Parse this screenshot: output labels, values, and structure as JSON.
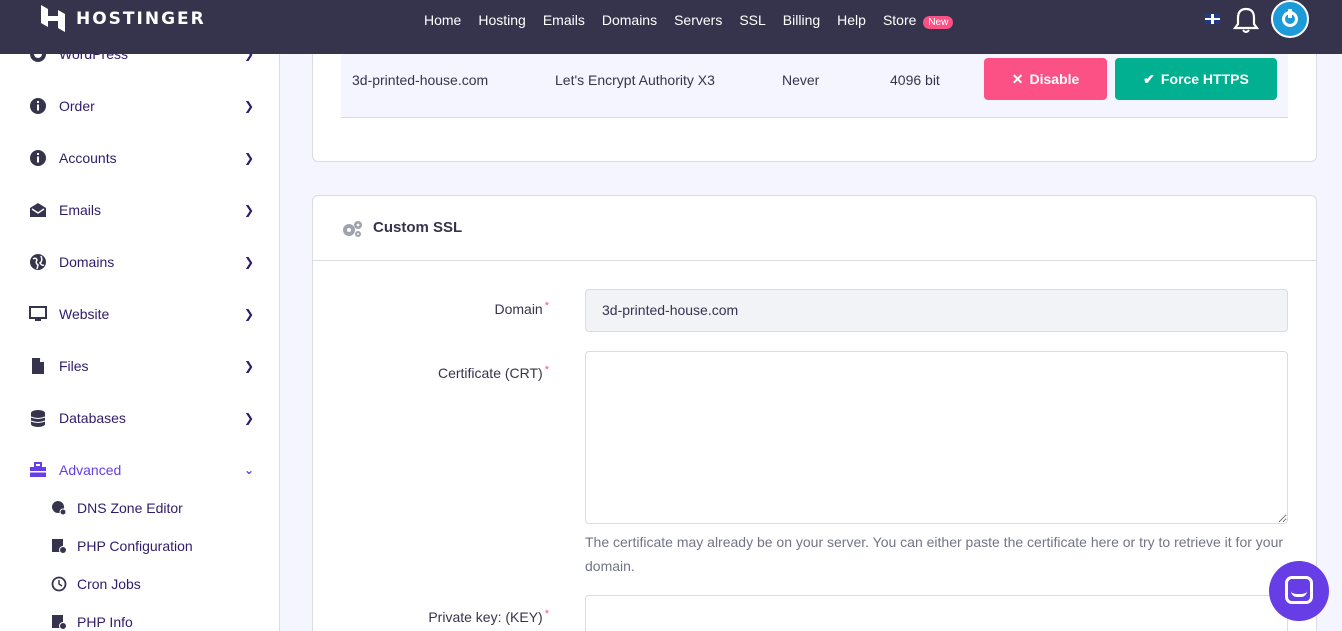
{
  "header": {
    "brand": "HOSTINGER",
    "nav": [
      {
        "label": "Home"
      },
      {
        "label": "Hosting"
      },
      {
        "label": "Emails"
      },
      {
        "label": "Domains"
      },
      {
        "label": "Servers"
      },
      {
        "label": "SSL"
      },
      {
        "label": "Billing"
      },
      {
        "label": "Help"
      },
      {
        "label": "Store",
        "badge": "New"
      }
    ]
  },
  "sidebar": {
    "items": [
      {
        "label": "WordPress",
        "icon": "wordpress-icon"
      },
      {
        "label": "Order",
        "icon": "info-icon"
      },
      {
        "label": "Accounts",
        "icon": "info-icon"
      },
      {
        "label": "Emails",
        "icon": "envelope-icon"
      },
      {
        "label": "Domains",
        "icon": "globe-icon"
      },
      {
        "label": "Website",
        "icon": "monitor-icon"
      },
      {
        "label": "Files",
        "icon": "file-icon"
      },
      {
        "label": "Databases",
        "icon": "database-icon"
      },
      {
        "label": "Advanced",
        "icon": "toolbox-icon",
        "active": true
      }
    ],
    "subitems": [
      {
        "label": "DNS Zone Editor",
        "icon": "dns-icon"
      },
      {
        "label": "PHP Configuration",
        "icon": "php-config-icon"
      },
      {
        "label": "Cron Jobs",
        "icon": "clock-icon"
      },
      {
        "label": "PHP Info",
        "icon": "php-info-icon"
      }
    ]
  },
  "ssl_table": {
    "row": {
      "domain": "3d-printed-house.com",
      "issuer": "Let's Encrypt Authority X3",
      "expires": "Never",
      "key_size": "4096 bit"
    },
    "disable_label": "Disable",
    "force_https_label": "Force HTTPS"
  },
  "custom_ssl": {
    "title": "Custom SSL",
    "domain_label": "Domain",
    "domain_value": "3d-printed-house.com",
    "crt_label": "Certificate (CRT)",
    "crt_help": "The certificate may already be on your server. You can either paste the certificate here or try to retrieve it for your domain.",
    "key_label": "Private key: (KEY)"
  },
  "colors": {
    "topbar": "#36344d",
    "accent": "#673de6",
    "danger": "#fc5185",
    "success": "#00b090"
  }
}
